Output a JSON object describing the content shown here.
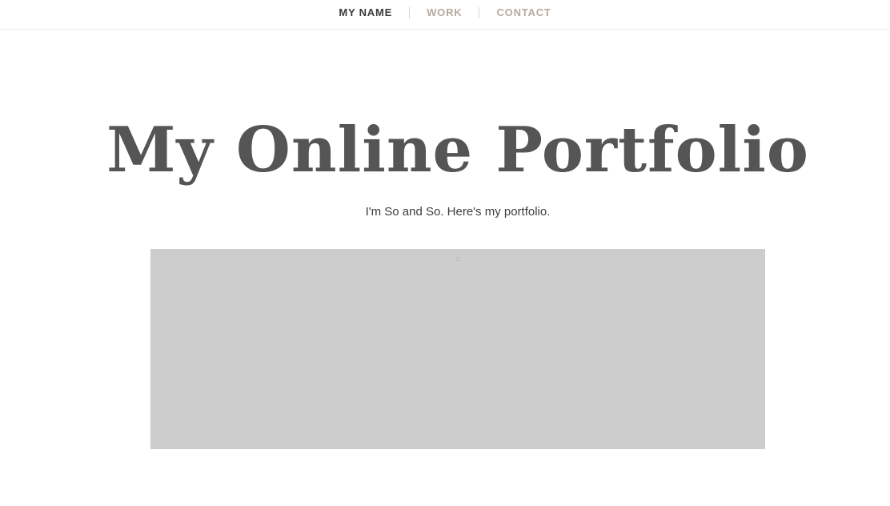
{
  "nav": {
    "items": [
      {
        "label": "MY NAME",
        "active": true
      },
      {
        "label": "WORK",
        "active": false
      },
      {
        "label": "CONTACT",
        "active": false
      }
    ],
    "active_color": "#3b3b3b",
    "inactive_color": "#b6aa9c"
  },
  "hero": {
    "title": "My Online Portfolio",
    "subtitle": "I'm So and So. Here's my portfolio."
  },
  "feature_image": {
    "icon": "broken-image-icon",
    "placeholder_color": "#cdcdcd"
  }
}
